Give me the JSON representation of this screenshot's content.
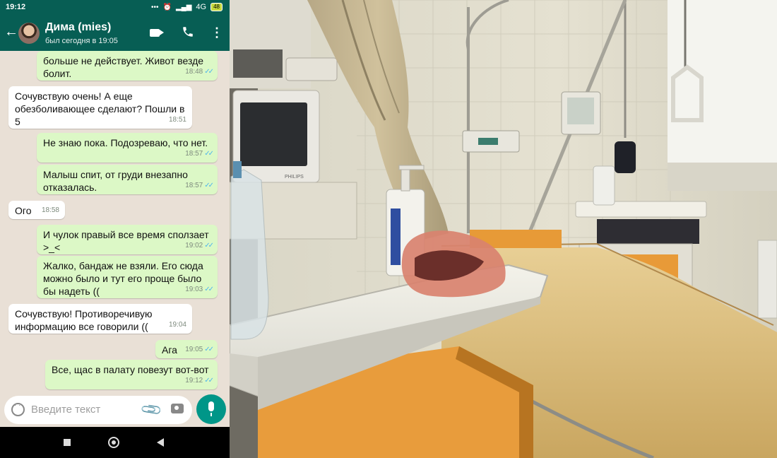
{
  "status_bar": {
    "time": "19:12",
    "network": "4G",
    "battery": "48"
  },
  "contact": {
    "name": "Дима (mies)",
    "last_seen": "был сегодня в 19:05"
  },
  "messages": [
    {
      "dir": "out",
      "text": "больше не действует. Живот везде болит.",
      "time": "18:48",
      "read": true
    },
    {
      "dir": "in",
      "text": "Сочувствую очень! А еще обезболивающее сделают? Пошли в 5",
      "time": "18:51"
    },
    {
      "dir": "out",
      "text": "Не знаю пока. Подозреваю, что нет.",
      "time": "18:57",
      "read": true
    },
    {
      "dir": "out",
      "text": "Малыш спит, от груди внезапно отказалась.",
      "time": "18:57",
      "read": true
    },
    {
      "dir": "in",
      "text": "Ого",
      "time": "18:58"
    },
    {
      "dir": "out",
      "text": "И чулок правый все время сползает >_<",
      "time": "19:02",
      "read": true
    },
    {
      "dir": "out",
      "text": "Жалко, бандаж не взяли. Его сюда можно было и тут его проще было бы надеть ((",
      "time": "19:03",
      "read": true
    },
    {
      "dir": "in",
      "text": "Сочувствую! Противоречивую информацию все говорили ((",
      "time": "19:04"
    },
    {
      "dir": "out",
      "text": "Ага",
      "time": "19:05",
      "read": true
    },
    {
      "dir": "out",
      "text": "Все, щас в палату повезут вот-вот",
      "time": "19:12",
      "read": true
    }
  ],
  "composer": {
    "placeholder": "Введите текст"
  },
  "photo": {
    "monitor_brand": "PHILIPS"
  }
}
